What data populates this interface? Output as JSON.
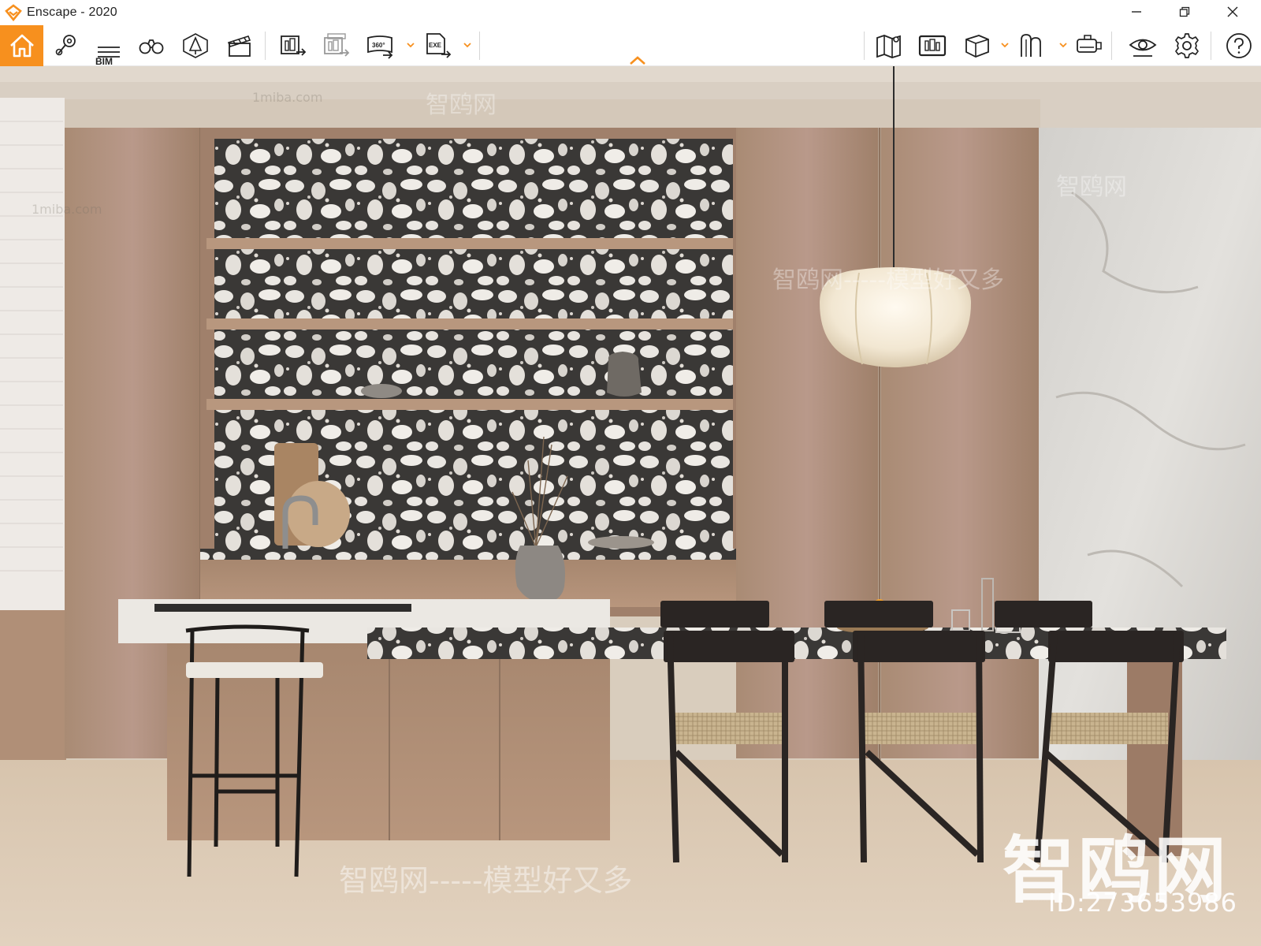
{
  "window": {
    "title": "Enscape - 2020",
    "accent_color": "#f7901e",
    "controls": [
      {
        "name": "minimize",
        "icon": "minimize-icon"
      },
      {
        "name": "restore",
        "icon": "restore-icon"
      },
      {
        "name": "close",
        "icon": "close-icon"
      }
    ]
  },
  "toolbar": {
    "left_tools": [
      {
        "id": "home",
        "icon": "home-icon"
      },
      {
        "id": "views",
        "icon": "location-pin-icon"
      },
      {
        "id": "bim",
        "icon": "bim-list-icon",
        "label": "BIM"
      },
      {
        "id": "binoculars",
        "icon": "binoculars-icon"
      },
      {
        "id": "asset-library",
        "icon": "asset-library-icon"
      },
      {
        "id": "video-editor",
        "icon": "clapperboard-icon"
      },
      {
        "id": "render-image",
        "icon": "render-image-icon"
      },
      {
        "id": "batch-render",
        "icon": "batch-render-icon"
      },
      {
        "id": "panorama",
        "icon": "panorama-360-icon",
        "label": "360°"
      },
      {
        "id": "export-exe",
        "icon": "export-exe-icon",
        "label": "EXE"
      }
    ],
    "right_tools": [
      {
        "id": "map",
        "icon": "map-icon"
      },
      {
        "id": "screenshot",
        "icon": "screenshot-icon"
      },
      {
        "id": "box",
        "icon": "box-icon"
      },
      {
        "id": "materials",
        "icon": "materials-icon"
      },
      {
        "id": "vr-headset",
        "icon": "vr-headset-icon"
      },
      {
        "id": "visual-settings",
        "icon": "eye-icon"
      },
      {
        "id": "settings",
        "icon": "gear-icon"
      },
      {
        "id": "help",
        "icon": "help-icon"
      }
    ]
  },
  "viewport": {
    "scene": "kitchen interior render",
    "watermarks": {
      "site": "1miba.com",
      "brand": "智鸥网",
      "slogan": "智鸥网-----模型好又多",
      "id_label": "ID:273653986"
    }
  }
}
